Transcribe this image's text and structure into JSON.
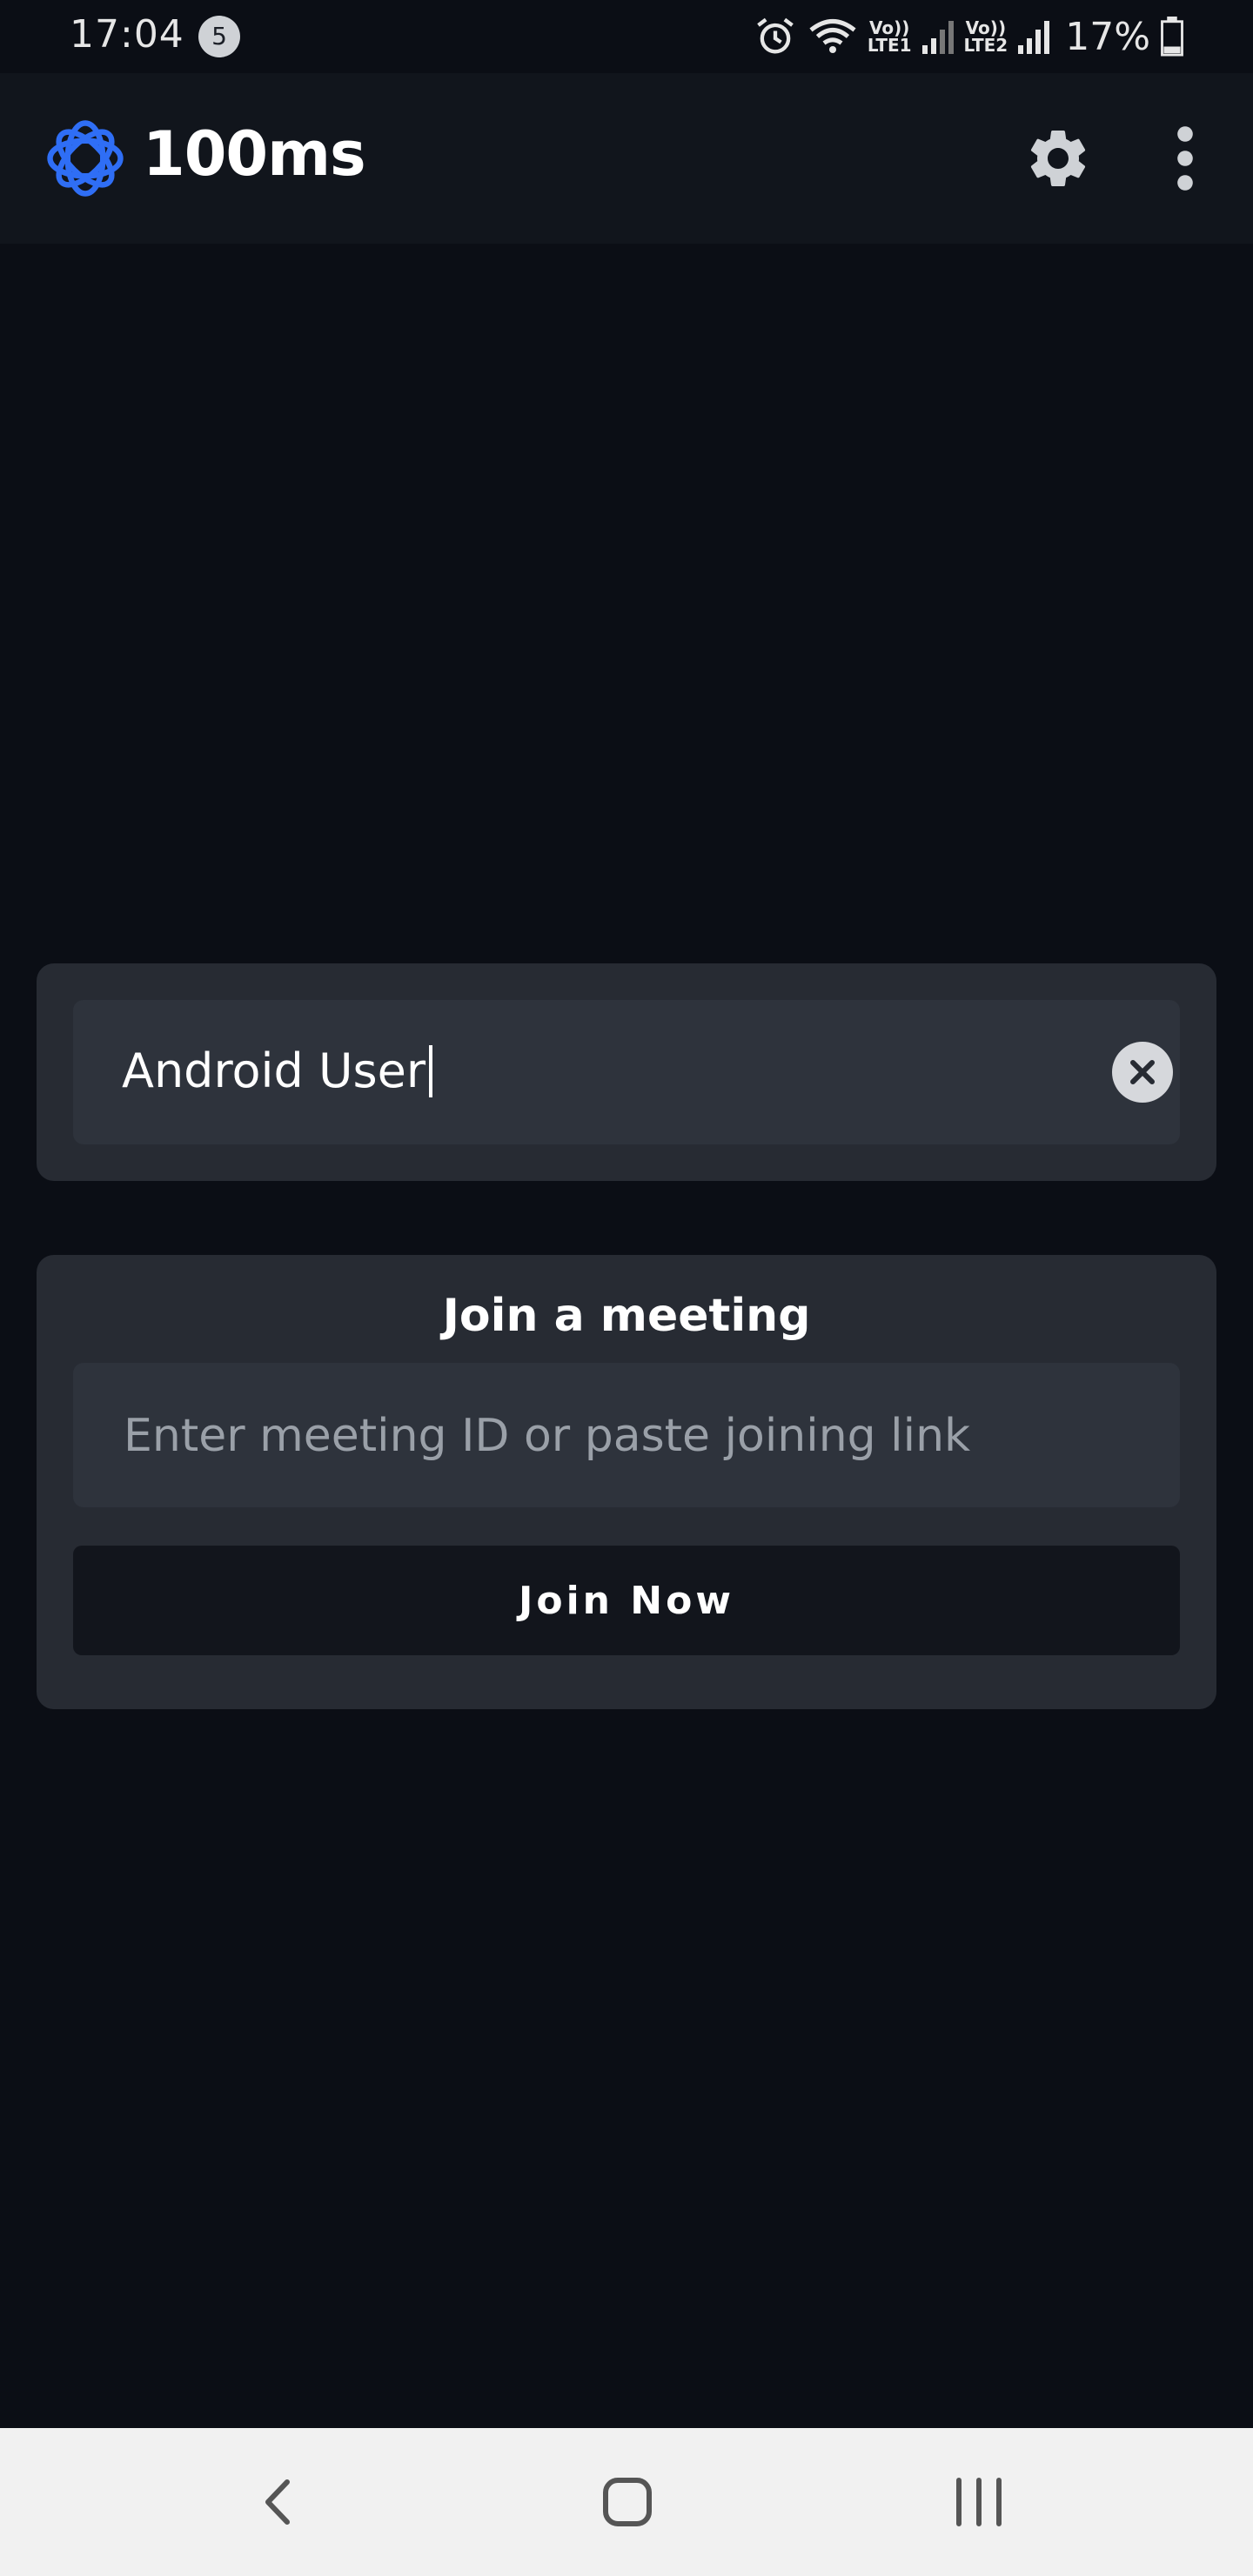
{
  "status_bar": {
    "time": "17:04",
    "notification_count": "5",
    "sim1_label": "LTE1",
    "sim2_label": "LTE2",
    "volte_label": "Vo))",
    "battery_percent": "17%"
  },
  "app_bar": {
    "title": "100ms",
    "brand_color": "#2f6ef5"
  },
  "name_card": {
    "name_value": "Android User"
  },
  "join_card": {
    "title": "Join a meeting",
    "meeting_placeholder": "Enter meeting ID or paste joining link",
    "join_button_label": "Join Now"
  },
  "icons": [
    "alarm-icon",
    "wifi-icon",
    "signal-icon",
    "battery-icon",
    "gear-icon",
    "more-vert-icon",
    "clear-icon",
    "back-icon",
    "home-icon",
    "recents-icon"
  ]
}
